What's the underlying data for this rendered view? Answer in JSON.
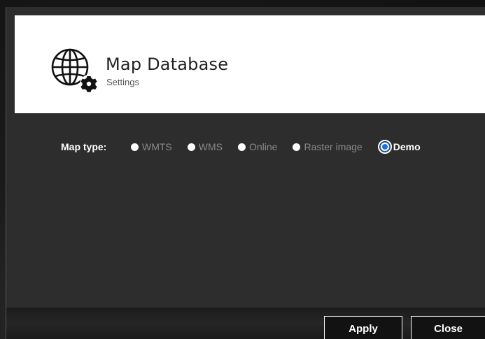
{
  "header": {
    "title": "Map Database",
    "subtitle": "Settings",
    "icon": "globe-gear-icon"
  },
  "map_type": {
    "label": "Map type:",
    "options": [
      {
        "label": "WMTS",
        "selected": false
      },
      {
        "label": "WMS",
        "selected": false
      },
      {
        "label": "Online",
        "selected": false
      },
      {
        "label": "Raster image",
        "selected": false
      },
      {
        "label": "Demo",
        "selected": true
      }
    ]
  },
  "footer": {
    "apply_label": "Apply",
    "close_label": "Close"
  },
  "colors": {
    "dialog_bg": "#2d2d2d",
    "header_bg": "#ffffff",
    "accent": "#1f6fe0",
    "inactive_text": "#8a8a8a"
  }
}
